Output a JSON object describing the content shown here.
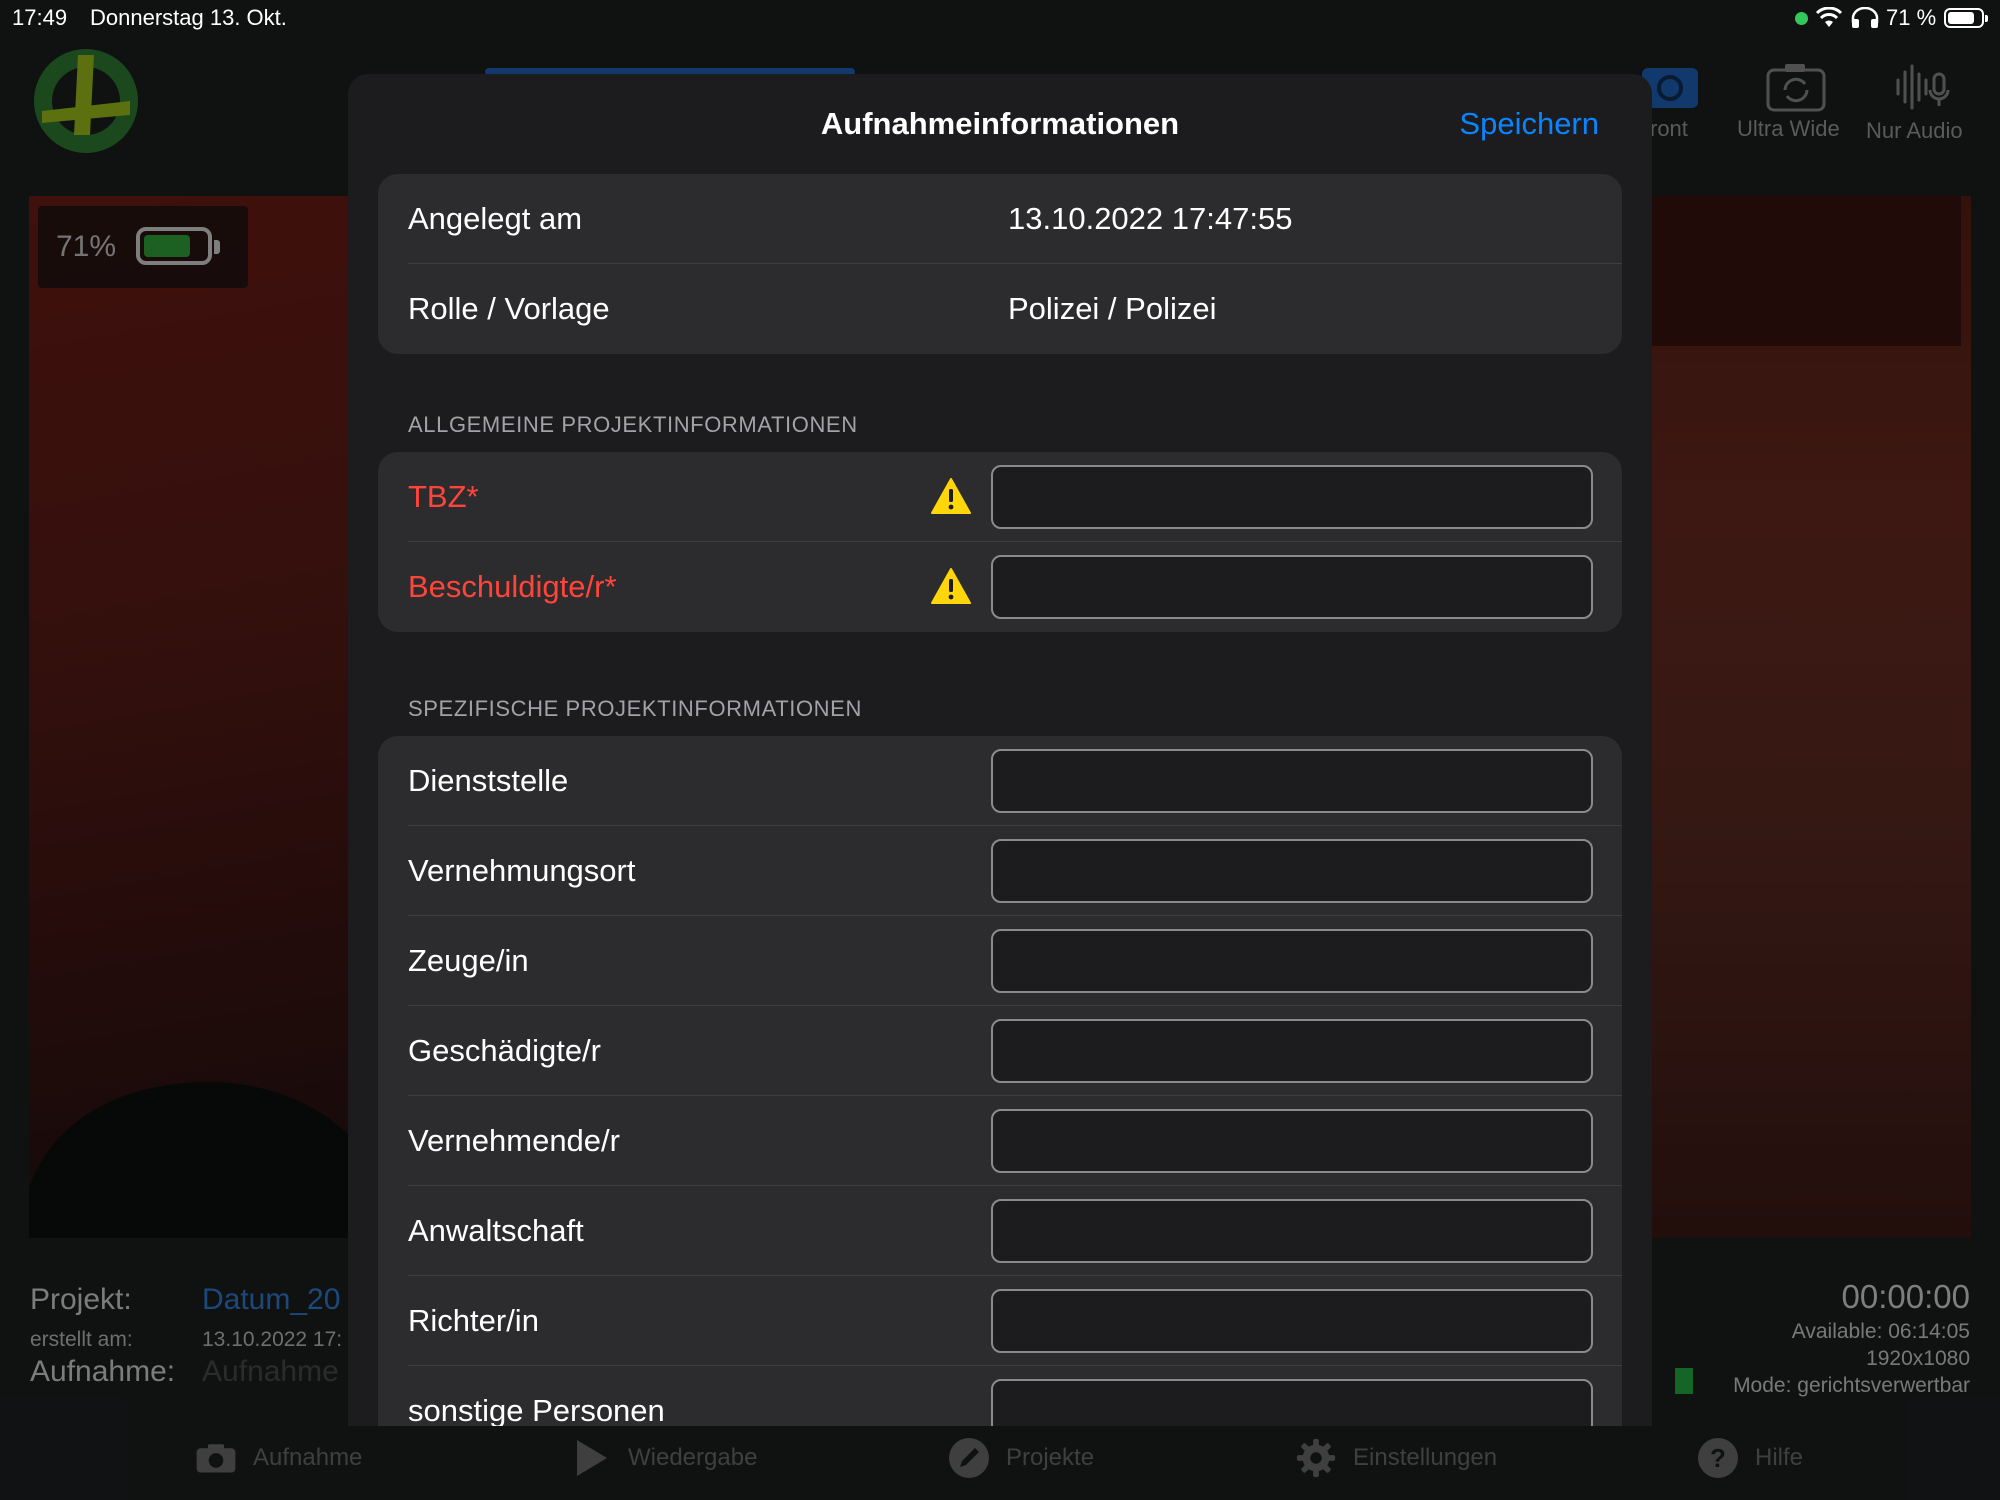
{
  "status_bar": {
    "time": "17:49",
    "date": "Donnerstag 13. Okt.",
    "battery_pct": "71 %"
  },
  "camera_view": {
    "battery_pct": "71%",
    "modes": [
      "ront",
      "Ultra Wide",
      "Nur Audio"
    ]
  },
  "project_info": {
    "projekt_label": "Projekt:",
    "projekt_value": "Datum_20",
    "erstellt_label": "erstellt am:",
    "erstellt_value": "13.10.2022 17:",
    "aufnahme_label": "Aufnahme:",
    "aufnahme_value": "Aufnahme"
  },
  "recording_status": {
    "timer": "00:00:00",
    "available": "Available: 06:14:05",
    "resolution": "1920x1080",
    "mode": "Mode: gerichtsverwertbar"
  },
  "tab_bar": {
    "items": [
      {
        "label": "Aufnahme",
        "icon": "camera-icon"
      },
      {
        "label": "Wiedergabe",
        "icon": "play-icon"
      },
      {
        "label": "Projekte",
        "icon": "pencil-icon"
      },
      {
        "label": "Einstellungen",
        "icon": "gear-icon"
      },
      {
        "label": "Hilfe",
        "icon": "question-icon"
      }
    ]
  },
  "modal": {
    "title": "Aufnahmeinformationen",
    "save_label": "Speichern",
    "meta_rows": [
      {
        "label": "Angelegt am",
        "value": "13.10.2022 17:47:55"
      },
      {
        "label": "Rolle / Vorlage",
        "value": "Polizei / Polizei"
      }
    ],
    "general_header": "ALLGEMEINE PROJEKTINFORMATIONEN",
    "general_fields": [
      {
        "label": "TBZ*",
        "value": ""
      },
      {
        "label": "Beschuldigte/r*",
        "value": ""
      }
    ],
    "specific_header": "SPEZIFISCHE PROJEKTINFORMATIONEN",
    "specific_fields": [
      {
        "label": "Dienststelle",
        "value": ""
      },
      {
        "label": "Vernehmungsort",
        "value": ""
      },
      {
        "label": "Zeuge/in",
        "value": ""
      },
      {
        "label": "Geschädigte/r",
        "value": ""
      },
      {
        "label": "Vernehmende/r",
        "value": ""
      },
      {
        "label": "Anwaltschaft",
        "value": ""
      },
      {
        "label": "Richter/in",
        "value": ""
      },
      {
        "label": "sonstige Personen",
        "value": ""
      }
    ]
  },
  "colors": {
    "accent": "#0a84ff",
    "required": "#ff453a",
    "warning": "#ffd60a",
    "record_ok": "#23b043"
  }
}
